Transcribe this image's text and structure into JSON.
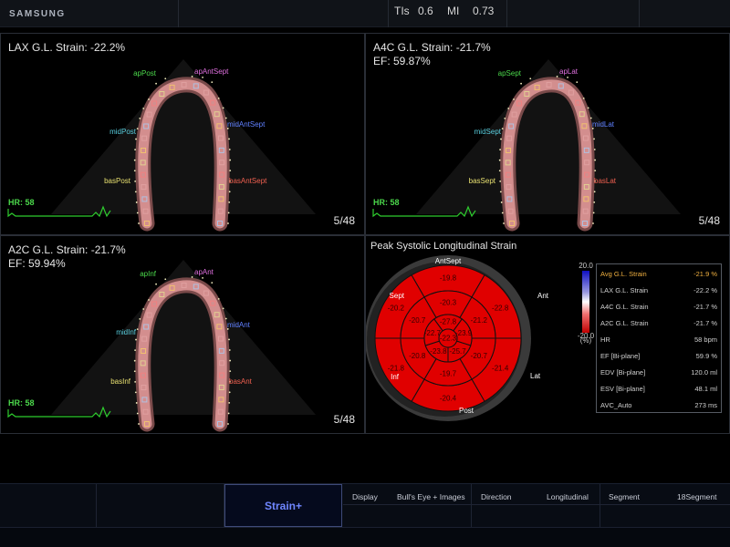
{
  "brand": "SAMSUNG",
  "header": {
    "tis_label": "TIs",
    "tis_value": "0.6",
    "mi_label": "MI",
    "mi_value": "0.73"
  },
  "colors": {
    "segment_red": "#e00000",
    "ecg_green": "#2ecc2e",
    "hr_green": "#4bd84b",
    "accent_blue": "#6f86ff"
  },
  "views": [
    {
      "title": "LAX G.L. Strain: -22.2%",
      "subtitle": "",
      "hr": "HR: 58",
      "frame": "5/48",
      "labels": {
        "ap_left": "apPost",
        "ap_right": "apAntSept",
        "mid_left": "midPost",
        "mid_right": "midAntSept",
        "bas_left": "basPost",
        "bas_right": "basAntSept"
      }
    },
    {
      "title": "A4C G.L. Strain: -21.7%",
      "subtitle": "EF: 59.87%",
      "hr": "HR: 58",
      "frame": "5/48",
      "labels": {
        "ap_left": "apSept",
        "ap_right": "apLat",
        "mid_left": "midSept",
        "mid_right": "midLat",
        "bas_left": "basSept",
        "bas_right": "basLat"
      }
    },
    {
      "title": "A2C G.L. Strain: -21.7%",
      "subtitle": "EF: 59.94%",
      "hr": "HR: 58",
      "frame": "5/48",
      "labels": {
        "ap_left": "apInf",
        "ap_right": "apAnt",
        "mid_left": "midInf",
        "mid_right": "midAnt",
        "bas_left": "basInf",
        "bas_right": "basAnt"
      }
    }
  ],
  "bullseye": {
    "title": "Peak Systolic Longitudinal Strain",
    "wall_labels": {
      "top": "AntSept",
      "top_right": "Ant",
      "right": "Lat",
      "bottom": "Post",
      "bottom_left": "Inf",
      "top_left": "Sept"
    },
    "outer_ring": [
      "-19.8",
      "-22.8",
      "-21.4",
      "-20.4",
      "-21.8",
      "-20.2"
    ],
    "mid_ring": [
      "-20.3",
      "-21.2",
      "-20.7",
      "-19.7",
      "-20.8",
      "-20.7"
    ],
    "inner_ring": [
      "-27.8",
      "-23.9",
      "-25.7",
      "-23.8",
      "-22.7"
    ],
    "apex": "-22.3",
    "colorbar": {
      "max_label": "20.0",
      "min_label": "-20.0",
      "unit": "(%)"
    }
  },
  "summary_table": [
    {
      "label": "Avg G.L. Strain",
      "value": "-21.9 %"
    },
    {
      "label": "LAX G.L. Strain",
      "value": "-22.2 %"
    },
    {
      "label": "A4C G.L. Strain",
      "value": "-21.7 %"
    },
    {
      "label": "A2C G.L. Strain",
      "value": "-21.7 %"
    },
    {
      "label": "HR",
      "value": "58 bpm"
    },
    {
      "label": "EF [Bi-plane]",
      "value": "59.9 %"
    },
    {
      "label": "EDV [Bi-plane]",
      "value": "120.0 ml"
    },
    {
      "label": "ESV [Bi-plane]",
      "value": "48.1 ml"
    },
    {
      "label": "AVC_Auto",
      "value": "273 ms"
    }
  ],
  "bottom": {
    "mode_button": "Strain+",
    "display_label": "Display",
    "display_value": "Bull's Eye + Images",
    "direction_label": "Direction",
    "direction_value": "Longitudinal",
    "segment_label": "Segment",
    "segment_value": "18Segment"
  }
}
